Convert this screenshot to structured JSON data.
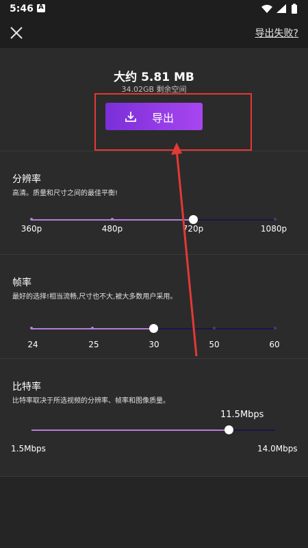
{
  "status_bar": {
    "time": "5:46",
    "badge_letter": "A"
  },
  "top_bar": {
    "export_failed_link": "导出失败?"
  },
  "export": {
    "size_text": "大约 5.81 MB",
    "storage_text": "34.02GB 剩余空间",
    "button_label": "导出"
  },
  "resolution": {
    "title": "分辨率",
    "description": "高清。质量和尺寸之间的最佳平衡!",
    "options": [
      "360p",
      "480p",
      "720p",
      "1080p"
    ],
    "selected": "720p"
  },
  "frame_rate": {
    "title": "帧率",
    "description": "最好的选择!相当流畅,尺寸也不大,被大多数用户采用。",
    "options": [
      "24",
      "25",
      "30",
      "50",
      "60"
    ],
    "selected": "30"
  },
  "bitrate": {
    "title": "比特率",
    "description": "比特率取决于所选视频的分辨率、帧率和图像质量。",
    "value": "11.5Mbps",
    "min": "1.5Mbps",
    "max": "14.0Mbps",
    "level_fraction": 0.81
  },
  "colors": {
    "accent_start": "#7a2fd8",
    "accent_end": "#a846f0",
    "slider_active": "#b57edc",
    "annotation_red": "#e53935"
  },
  "icons": {
    "close": "close-icon",
    "download": "download-icon",
    "wifi": "wifi-icon",
    "signal": "signal-icon",
    "battery": "battery-icon"
  }
}
